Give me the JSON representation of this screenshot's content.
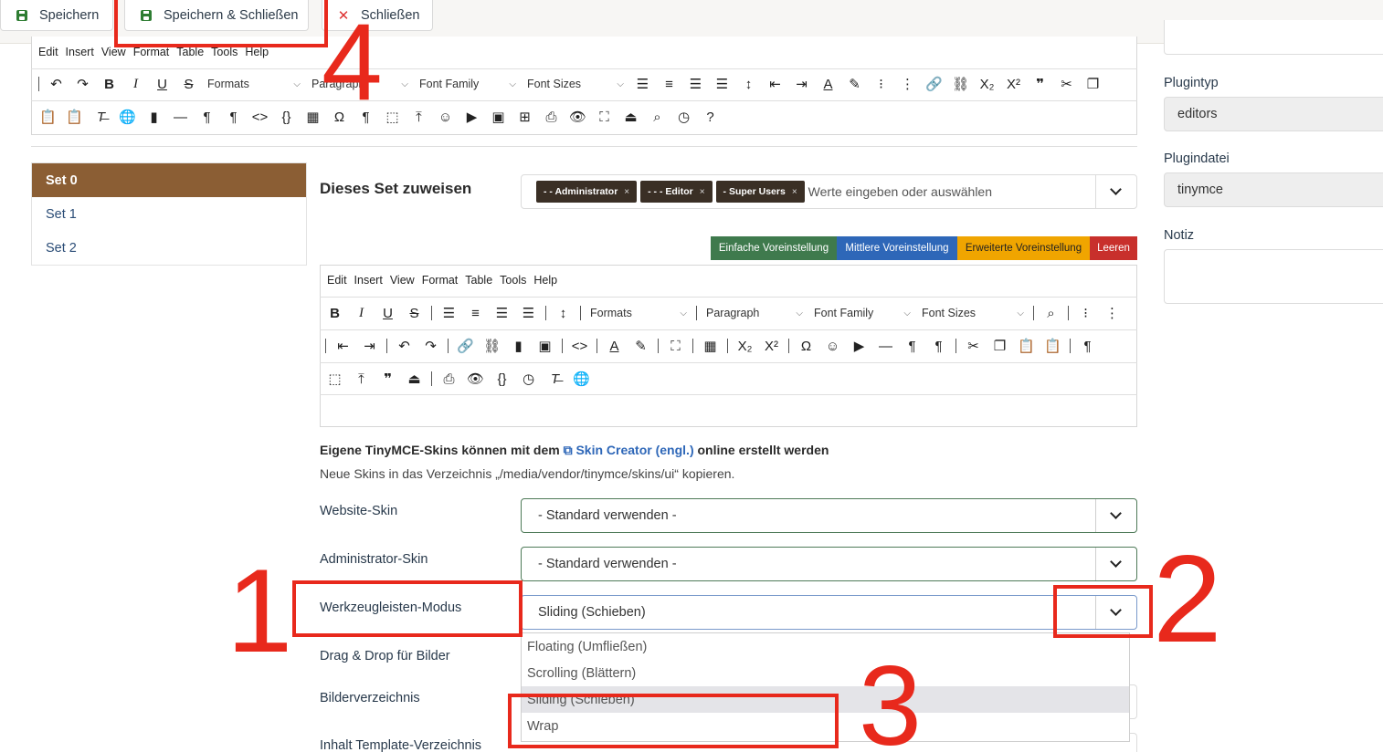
{
  "toolbar": {
    "save": "Speichern",
    "save_close": "Speichern & Schließen",
    "close": "Schließen"
  },
  "top_editor": {
    "menu": [
      "Edit",
      "Insert",
      "View",
      "Format",
      "Table",
      "Tools",
      "Help"
    ],
    "formats": "Formats",
    "paragraph": "Paragraph",
    "font_family": "Font Family",
    "font_sizes": "Font Sizes"
  },
  "sets": [
    {
      "label": "Set 0",
      "active": true
    },
    {
      "label": "Set 1",
      "active": false
    },
    {
      "label": "Set 2",
      "active": false
    }
  ],
  "assign": {
    "heading": "Dieses Set zuweisen",
    "chips": [
      "- - Administrator",
      "- - - Editor",
      "- Super Users"
    ],
    "chip_remove": "×",
    "placeholder": "Werte eingeben oder auswählen"
  },
  "presets": [
    {
      "label": "Einfache Voreinstellung",
      "color": "#3f7a4d"
    },
    {
      "label": "Mittlere Voreinstellung",
      "color": "#2e67b8"
    },
    {
      "label": "Erweiterte Voreinstellung",
      "color": "#f0a500"
    },
    {
      "label": "Leeren",
      "color": "#c8302c"
    }
  ],
  "inner_editor": {
    "menu": [
      "Edit",
      "Insert",
      "View",
      "Format",
      "Table",
      "Tools",
      "Help"
    ],
    "formats": "Formats",
    "paragraph": "Paragraph",
    "font_family": "Font Family",
    "font_sizes": "Font Sizes"
  },
  "skins": {
    "note_prefix": "Eigene TinyMCE-Skins können mit dem ",
    "link": "Skin Creator (engl.)",
    "note_suffix": " online erstellt werden",
    "subnote": "Neue Skins in das Verzeichnis „/media/vendor/tinymce/skins/ui“ kopieren."
  },
  "fields": {
    "website_skin": {
      "label": "Website-Skin",
      "value": "- Standard verwenden -"
    },
    "admin_skin": {
      "label": "Administrator-Skin",
      "value": "- Standard verwenden -"
    },
    "toolbar_mode": {
      "label": "Werkzeugleisten-Modus",
      "value": "Sliding (Schieben)"
    },
    "drag_drop": {
      "label": "Drag & Drop für Bilder"
    },
    "image_dir": {
      "label": "Bilderverzeichnis"
    },
    "template_dir": {
      "label": "Inhalt Template-Verzeichnis"
    }
  },
  "dropdown_options": [
    {
      "label": "Floating (Umfließen)",
      "highlighted": false
    },
    {
      "label": "Scrolling (Blättern)",
      "highlighted": false
    },
    {
      "label": "Sliding (Schieben)",
      "highlighted": true
    },
    {
      "label": "Wrap",
      "highlighted": false
    }
  ],
  "right_panel": {
    "plugintyp_label": "Plugintyp",
    "plugintyp_value": "editors",
    "plugindatei_label": "Plugindatei",
    "plugindatei_value": "tinymce",
    "notiz_label": "Notiz"
  },
  "annotations": [
    "1",
    "2",
    "3",
    "4"
  ],
  "colors": {
    "annotation_red": "#e8291c",
    "active_set": "#8b5e34"
  }
}
